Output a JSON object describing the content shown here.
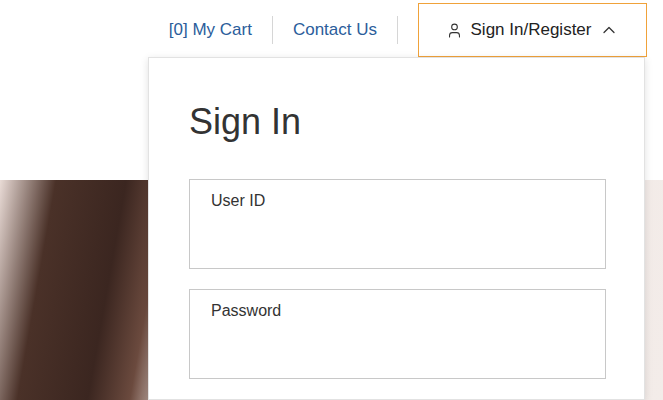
{
  "header": {
    "links": [
      {
        "label": "[0] My Cart"
      },
      {
        "label": "Contact Us"
      }
    ],
    "account_button": {
      "label": "Sign In/Register",
      "expanded": true
    }
  },
  "sign_in_panel": {
    "title": "Sign In",
    "fields": [
      {
        "label": "User ID",
        "value": ""
      },
      {
        "label": "Password",
        "value": ""
      }
    ]
  }
}
